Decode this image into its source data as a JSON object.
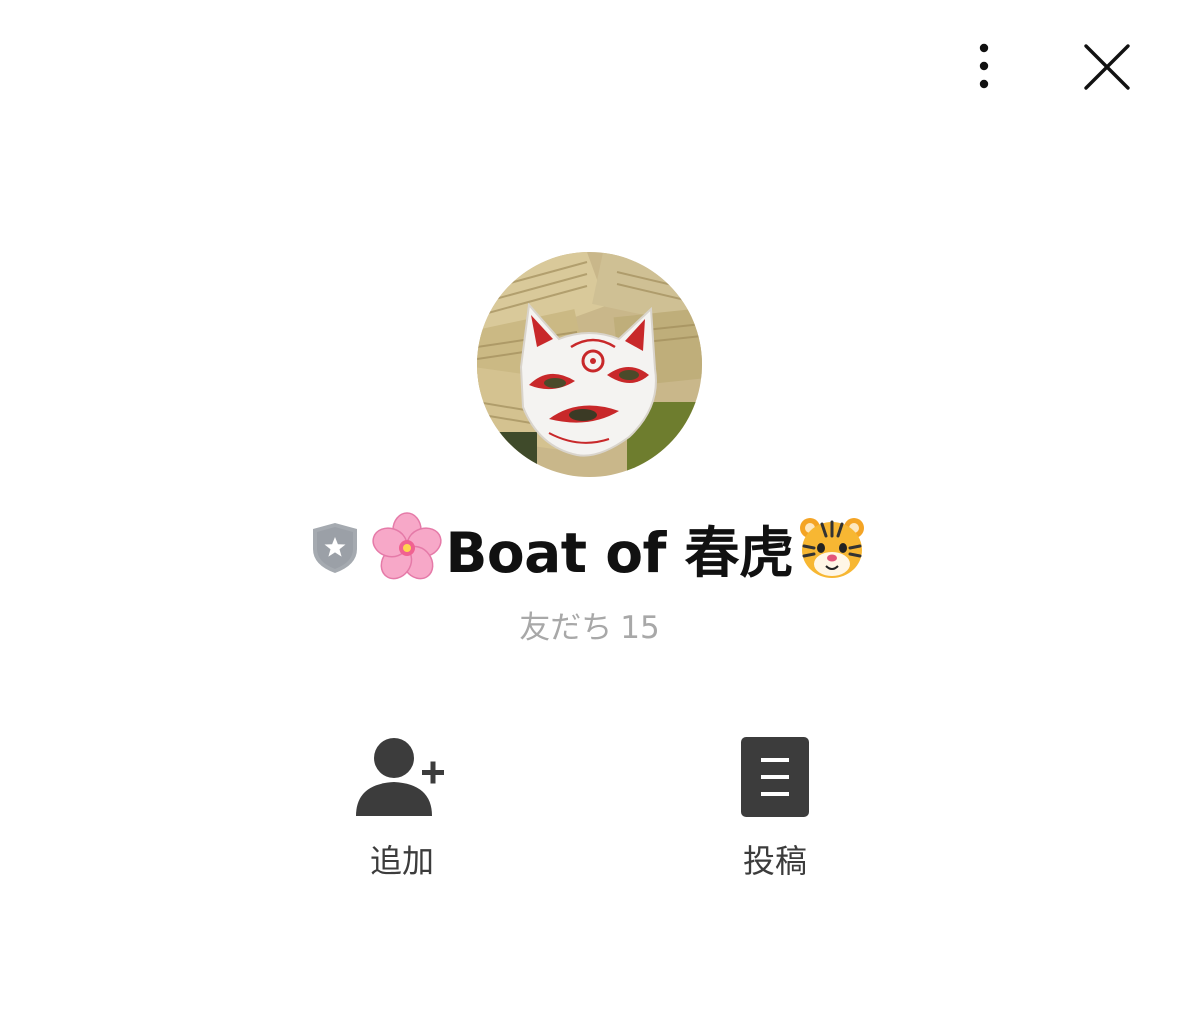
{
  "header": {
    "more_icon": "vertical-ellipsis-icon",
    "close_icon": "close-x-icon"
  },
  "profile": {
    "avatar": "fox-mask-with-banknotes",
    "badge_icon": "shield-star-icon",
    "leading_emoji_icon": "cherry-blossom-icon",
    "name": "Boat of 春虎",
    "trailing_emoji_icon": "tiger-face-icon",
    "friends_label": "友だち",
    "friends_count": "15"
  },
  "actions": [
    {
      "label": "追加",
      "icon": "add-friend-icon"
    },
    {
      "label": "投稿",
      "icon": "post-document-icon"
    }
  ],
  "colors": {
    "text_primary": "#111111",
    "text_secondary": "#a8a8a8",
    "icon_dark": "#3c3c3c",
    "badge_gray": "#a5aab0",
    "background": "#ffffff"
  }
}
